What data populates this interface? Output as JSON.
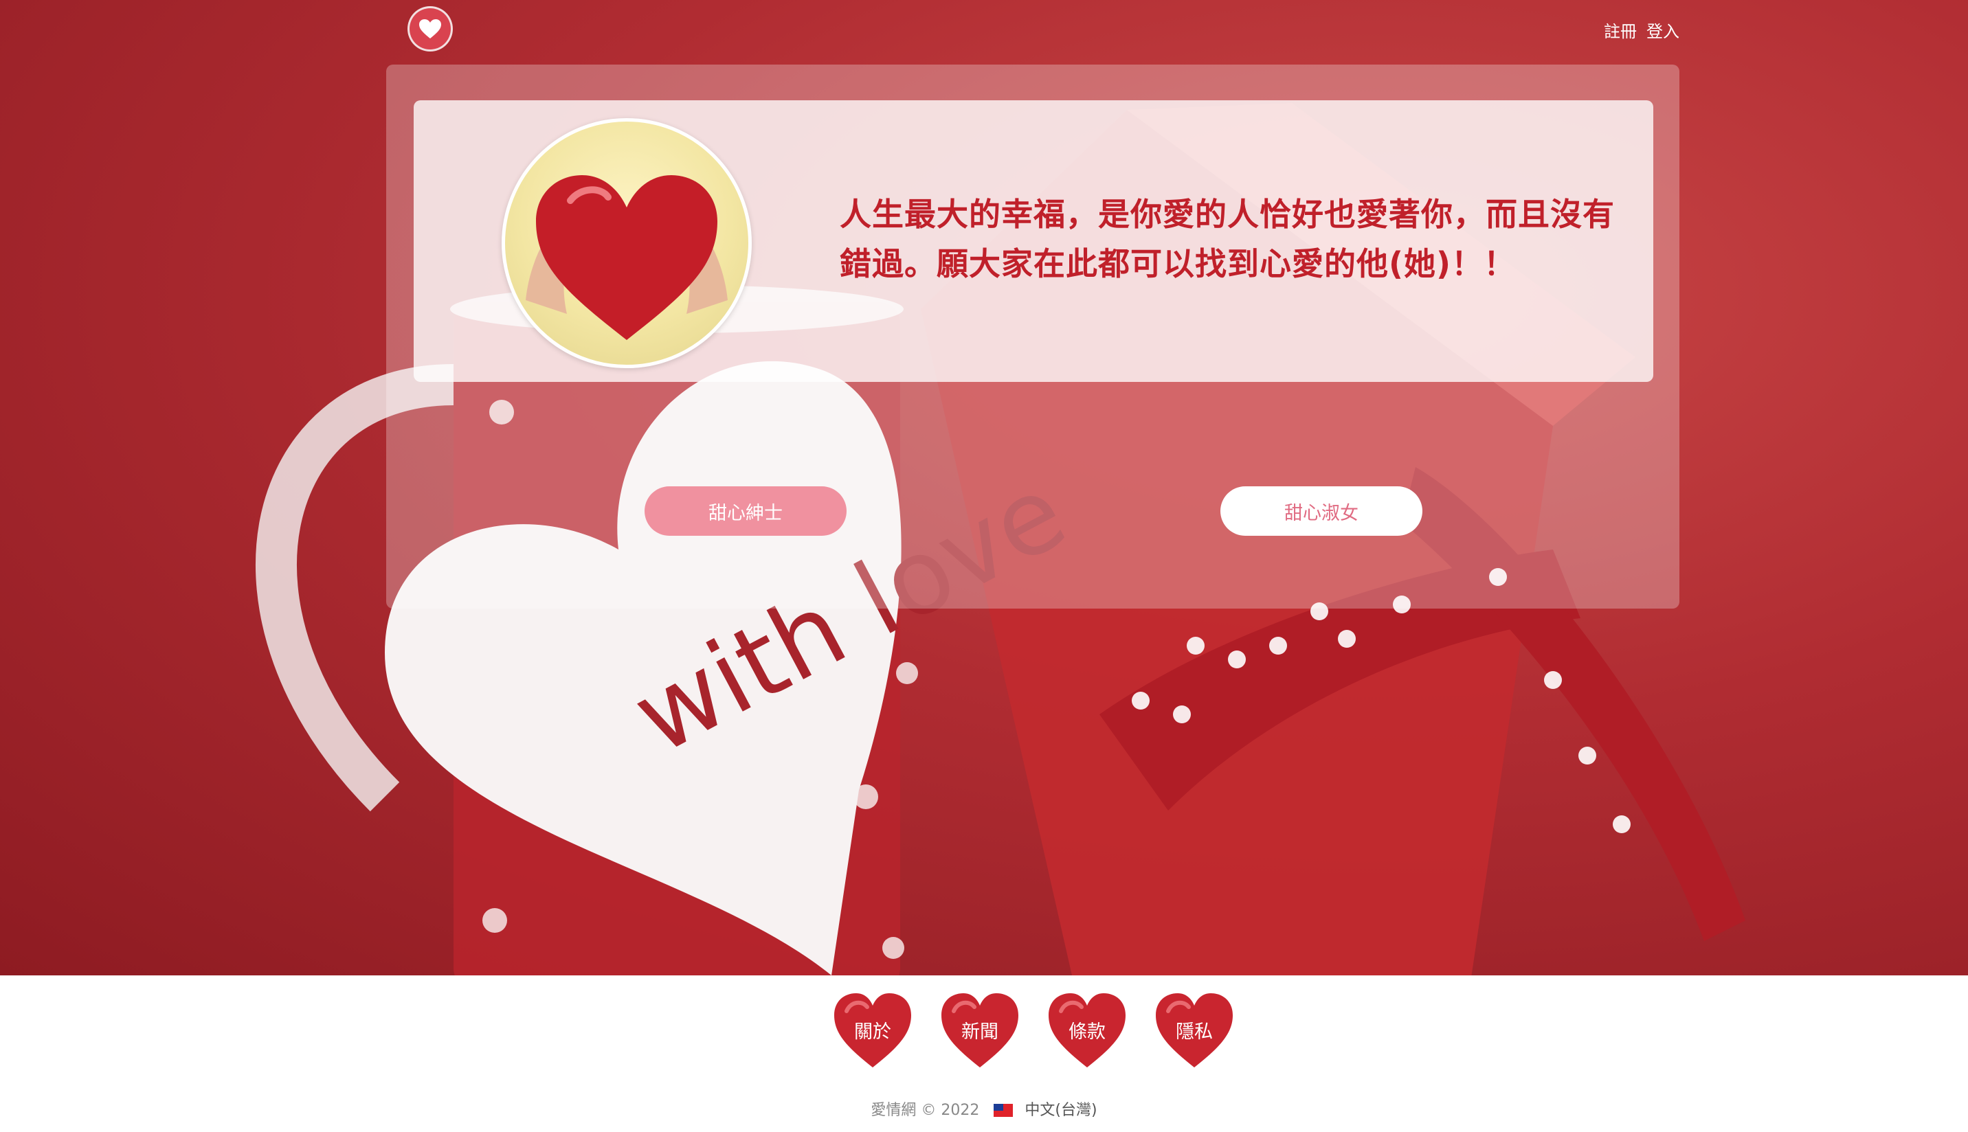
{
  "header": {
    "logo_icon": "heart-icon",
    "register_label": "註冊",
    "login_label": "登入"
  },
  "hero": {
    "background_text": "with love",
    "quote": "人生最大的幸福，是你愛的人恰好也愛著你，而且沒有錯過。願大家在此都可以找到心愛的他(她)！！"
  },
  "buttons": {
    "gentleman": "甜心紳士",
    "lady": "甜心淑女"
  },
  "footer": {
    "links": [
      {
        "label": "關於",
        "icon": "heart-icon"
      },
      {
        "label": "新聞",
        "icon": "heart-icon"
      },
      {
        "label": "條款",
        "icon": "heart-icon"
      },
      {
        "label": "隱私",
        "icon": "heart-icon"
      }
    ],
    "copyright": "愛情網 © 2022",
    "language": "中文(台灣)"
  },
  "colors": {
    "accent": "#c0202a",
    "button_pink": "#f0919f",
    "heart_red": "#c9252f"
  }
}
